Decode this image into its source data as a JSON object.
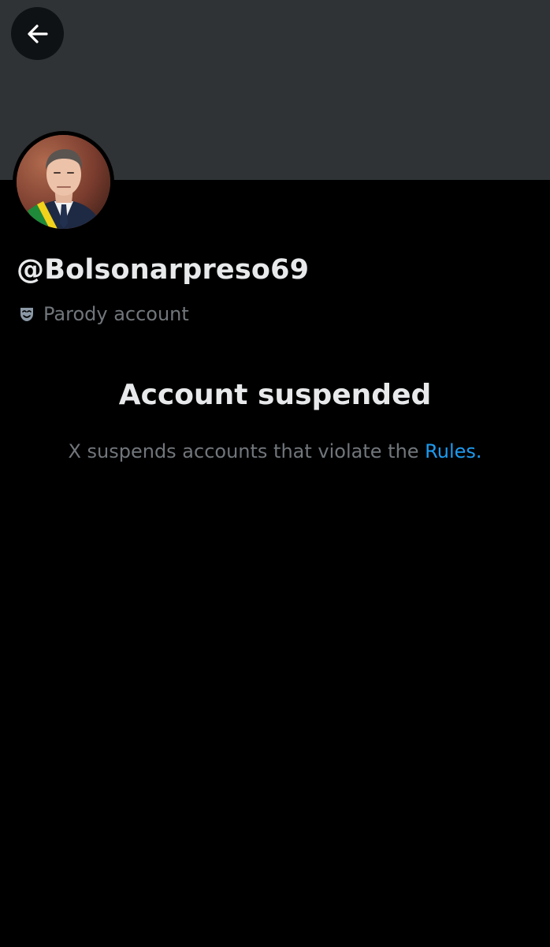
{
  "header": {
    "back_icon": "arrow-left-icon"
  },
  "profile": {
    "avatar_icon": "profile-photo",
    "handle": "@Bolsonarpreso69",
    "parody_icon": "theater-mask-icon",
    "parody_label": "Parody account"
  },
  "notice": {
    "title": "Account suspended",
    "description_prefix": "X suspends accounts that violate the ",
    "rules_link": "Rules",
    "description_suffix": "."
  },
  "colors": {
    "banner": "#2f3336",
    "background": "#000000",
    "primary_text": "#e7e9ea",
    "secondary_text": "#71767b",
    "link": "#1d9bf0"
  }
}
